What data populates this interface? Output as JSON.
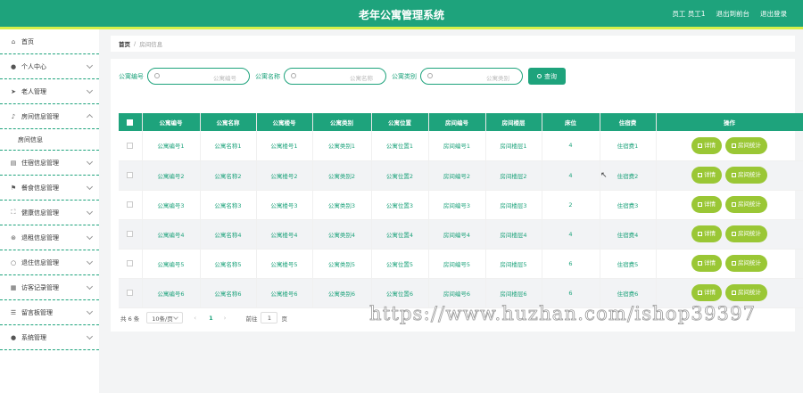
{
  "app": {
    "title": "老年公寓管理系统",
    "user_label": "员工 员工1",
    "front_link": "退出到前台",
    "logout_link": "退出登录"
  },
  "sidebar": {
    "items": [
      {
        "label": "首页",
        "icon": "home-icon",
        "glyph": "⌂",
        "chevron": false
      },
      {
        "label": "个人中心",
        "icon": "user-icon",
        "glyph": "●",
        "chevron": true
      },
      {
        "label": "老人管理",
        "icon": "send-icon",
        "glyph": "➤",
        "chevron": true
      },
      {
        "label": "房间信息管理",
        "icon": "mic-icon",
        "glyph": "♪",
        "chevron": true,
        "expanded": true
      },
      {
        "label": "住宿信息管理",
        "icon": "ticket-icon",
        "glyph": "▤",
        "chevron": true
      },
      {
        "label": "餐食信息管理",
        "icon": "flag-icon",
        "glyph": "⚑",
        "chevron": true
      },
      {
        "label": "健康信息管理",
        "icon": "frame-icon",
        "glyph": "⛶",
        "chevron": true
      },
      {
        "label": "退租信息管理",
        "icon": "steering-icon",
        "glyph": "⊛",
        "chevron": true
      },
      {
        "label": "退住信息管理",
        "icon": "ring-icon",
        "glyph": "○",
        "chevron": true
      },
      {
        "label": "访客记录管理",
        "icon": "grid-icon",
        "glyph": "▦",
        "chevron": true
      },
      {
        "label": "留言板管理",
        "icon": "list-icon",
        "glyph": "☰",
        "chevron": true
      },
      {
        "label": "系统管理",
        "icon": "location-icon",
        "glyph": "●",
        "chevron": true
      }
    ],
    "sub_item": "房间信息"
  },
  "breadcrumb": {
    "home": "首页",
    "sep": "/",
    "current": "房间信息"
  },
  "search": {
    "fields": [
      {
        "label": "公寓编号",
        "placeholder": "公寓编号"
      },
      {
        "label": "公寓名称",
        "placeholder": "公寓名称"
      },
      {
        "label": "公寓类别",
        "placeholder": "公寓类别"
      }
    ],
    "button": "查询"
  },
  "table": {
    "headers": [
      "公寓编号",
      "公寓名称",
      "公寓楼号",
      "公寓类别",
      "公寓位置",
      "房间编号",
      "房间楼层",
      "床位",
      "住宿费",
      "操作"
    ],
    "rows": [
      [
        "公寓编号1",
        "公寓名称1",
        "公寓楼号1",
        "公寓类别1",
        "公寓位置1",
        "房间编号1",
        "房间楼层1",
        "4",
        "住宿费1"
      ],
      [
        "公寓编号2",
        "公寓名称2",
        "公寓楼号2",
        "公寓类别2",
        "公寓位置2",
        "房间编号2",
        "房间楼层2",
        "4",
        "住宿费2"
      ],
      [
        "公寓编号3",
        "公寓名称3",
        "公寓楼号3",
        "公寓类别3",
        "公寓位置3",
        "房间编号3",
        "房间楼层3",
        "2",
        "住宿费3"
      ],
      [
        "公寓编号4",
        "公寓名称4",
        "公寓楼号4",
        "公寓类别4",
        "公寓位置4",
        "房间编号4",
        "房间楼层4",
        "4",
        "住宿费4"
      ],
      [
        "公寓编号5",
        "公寓名称5",
        "公寓楼号5",
        "公寓类别5",
        "公寓位置5",
        "房间编号5",
        "房间楼层5",
        "6",
        "住宿费5"
      ],
      [
        "公寓编号6",
        "公寓名称6",
        "公寓楼号6",
        "公寓类别6",
        "公寓位置6",
        "房间编号6",
        "房间楼层6",
        "6",
        "住宿费6"
      ]
    ],
    "actions": [
      "详情",
      "房间统计"
    ]
  },
  "pagination": {
    "total": "共 6 条",
    "page_size": "10条/页",
    "prev": "‹",
    "next": "›",
    "current_page": "1",
    "goto_label": "前往",
    "goto_value": "1",
    "page_unit": "页"
  },
  "watermark": "https://www.huzhan.com/ishop39397",
  "colors": {
    "primary": "#1ea37c",
    "accent": "#d7ef4a",
    "action": "#9ac735"
  }
}
